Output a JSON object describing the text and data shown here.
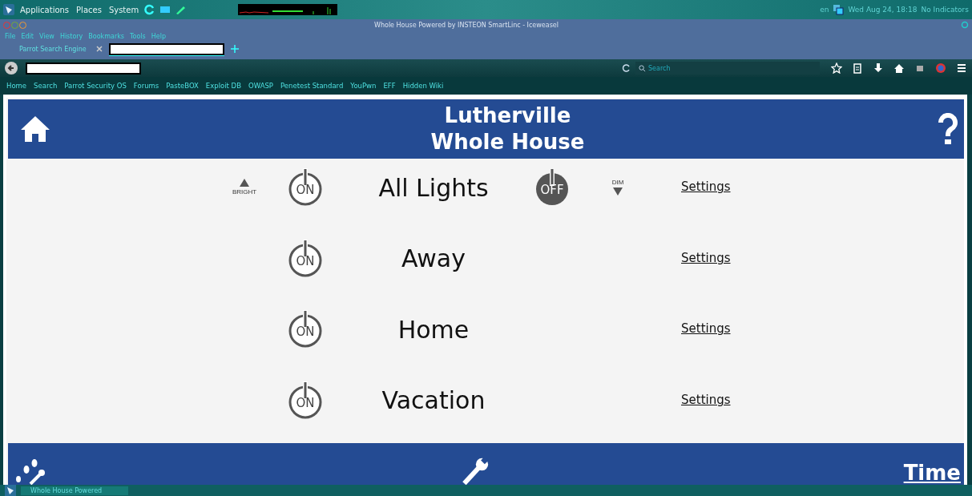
{
  "panel": {
    "menus": [
      "Applications",
      "Places",
      "System"
    ],
    "keyboard": "en",
    "clock": "Wed Aug 24, 18:18",
    "indicators": "No Indicators"
  },
  "window": {
    "title": "Whole House Powered by INSTEON SmartLinc - Iceweasel"
  },
  "menu_bar": [
    "File",
    "Edit",
    "View",
    "History",
    "Bookmarks",
    "Tools",
    "Help"
  ],
  "tabs": [
    {
      "label": "Parrot Search Engine",
      "selected": false,
      "redacted": false
    },
    {
      "selected": true,
      "redacted": true
    }
  ],
  "search": {
    "placeholder": "Search"
  },
  "bookmarks": [
    "Home",
    "Search",
    "Parrot Security OS",
    "Forums",
    "PasteBOX",
    "Exploit DB",
    "OWASP",
    "Penetest Standard",
    "YouPwn",
    "EFF",
    "Hidden Wiki"
  ],
  "page": {
    "title_lines": [
      "Lutherville",
      "Whole House"
    ],
    "rows": [
      {
        "kind": "dimmable",
        "name": "All Lights",
        "on_label": "ON",
        "off_label": "OFF",
        "bright_label": "BRIGHT",
        "dim_label": "DIM",
        "settings": "Settings"
      },
      {
        "kind": "scene",
        "name": "Away",
        "on_label": "ON",
        "settings": "Settings"
      },
      {
        "kind": "scene",
        "name": "Home",
        "on_label": "ON",
        "settings": "Settings"
      },
      {
        "kind": "scene",
        "name": "Vacation",
        "on_label": "ON",
        "settings": "Settings"
      }
    ],
    "footer_link": "Time"
  },
  "taskbar": {
    "window_button": "Whole House Powered"
  }
}
